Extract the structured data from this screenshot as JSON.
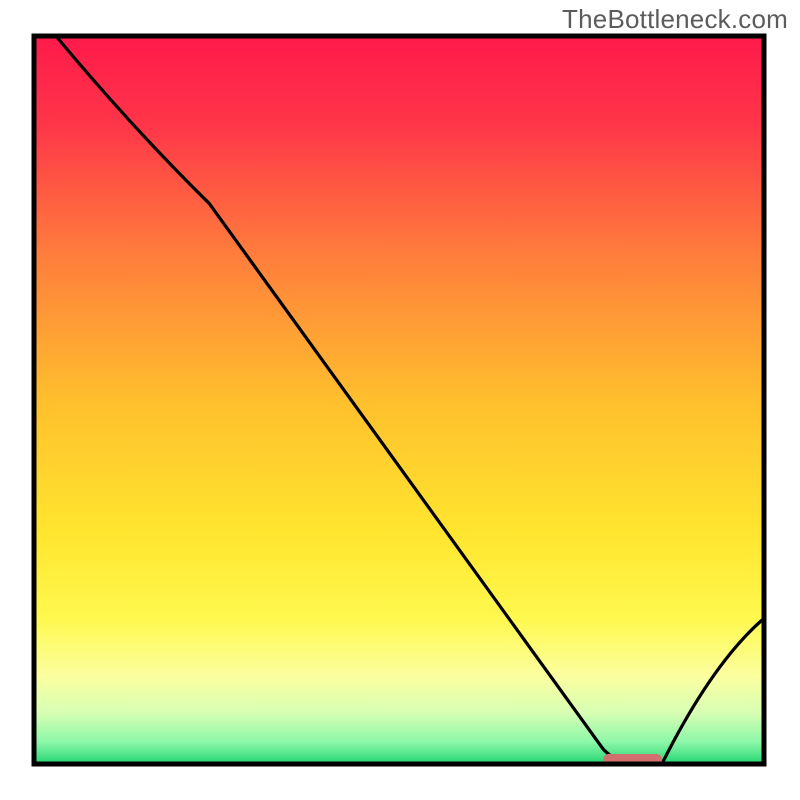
{
  "watermark": "TheBottleneck.com",
  "chart_data": {
    "type": "line",
    "title": "",
    "xlabel": "",
    "ylabel": "",
    "xlim": [
      0,
      100
    ],
    "ylim": [
      0,
      100
    ],
    "marker": {
      "x_range": [
        78,
        86
      ],
      "y": 0,
      "color": "#d27070"
    },
    "series": [
      {
        "name": "curve",
        "description": "Bottleneck curve descending to a minimum near x≈82 then rising",
        "points": [
          {
            "x": 3,
            "y": 100
          },
          {
            "x": 24,
            "y": 77
          },
          {
            "x": 78,
            "y": 2
          },
          {
            "x": 82,
            "y": 0
          },
          {
            "x": 86,
            "y": 0
          },
          {
            "x": 100,
            "y": 20
          }
        ]
      }
    ],
    "background_gradient": {
      "stops": [
        {
          "offset": 0.0,
          "color": "#ff1a4b"
        },
        {
          "offset": 0.12,
          "color": "#ff3549"
        },
        {
          "offset": 0.3,
          "color": "#ff7d3c"
        },
        {
          "offset": 0.5,
          "color": "#ffbf2d"
        },
        {
          "offset": 0.68,
          "color": "#ffe52e"
        },
        {
          "offset": 0.8,
          "color": "#fff84e"
        },
        {
          "offset": 0.88,
          "color": "#fbffa0"
        },
        {
          "offset": 0.93,
          "color": "#d7ffb4"
        },
        {
          "offset": 0.97,
          "color": "#8cf7a8"
        },
        {
          "offset": 1.0,
          "color": "#23d672"
        }
      ]
    },
    "frame_color": "#000000",
    "curve_color": "#000000"
  }
}
